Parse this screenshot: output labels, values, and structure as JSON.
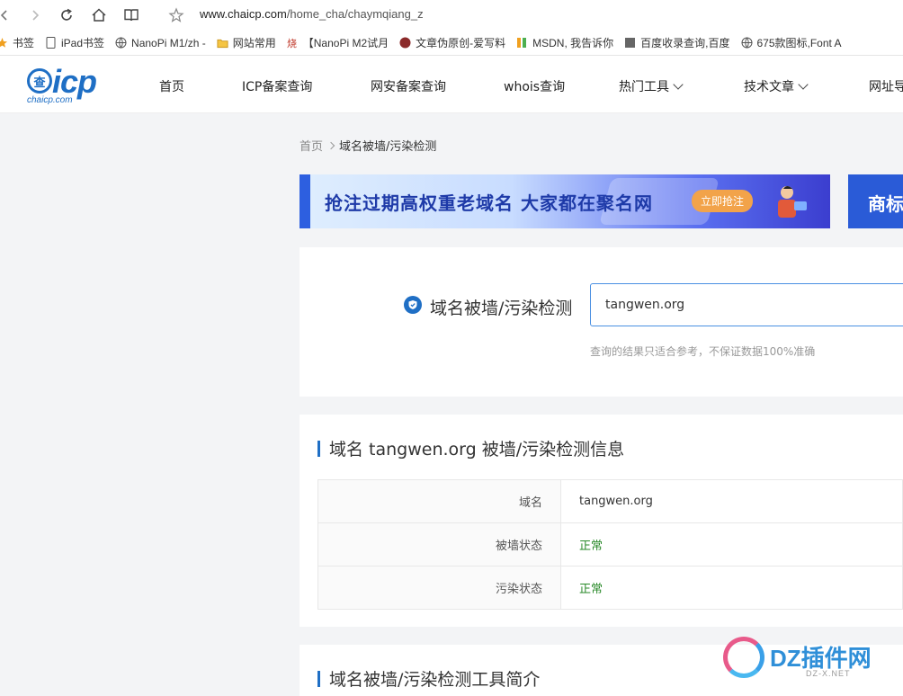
{
  "browser": {
    "url_host": "www.chaicp.com",
    "url_path": "/home_cha/chaymqiang_z"
  },
  "bookmarks": [
    {
      "label": "书签",
      "icon": "star-icon"
    },
    {
      "label": "iPad书签",
      "icon": "tablet-icon"
    },
    {
      "label": "NanoPi M1/zh -",
      "icon": "globe-icon"
    },
    {
      "label": "网站常用",
      "icon": "folder-icon"
    },
    {
      "label": "【NanoPi M2试月",
      "icon": "site-icon"
    },
    {
      "label": "文章伪原创-爱写料",
      "icon": "site-icon"
    },
    {
      "label": "MSDN, 我告诉你",
      "icon": "site-icon"
    },
    {
      "label": "百度收录查询,百度",
      "icon": "site-icon"
    },
    {
      "label": "675款图标,Font A",
      "icon": "globe-icon"
    }
  ],
  "site": {
    "logo_cha": "查",
    "logo_icp": "icp",
    "logo_domain": "chaicp.com",
    "menu": [
      "首页",
      "ICP备案查询",
      "网安备案查询",
      "whois查询",
      "热门工具",
      "技术文章",
      "网址导"
    ]
  },
  "breadcrumb": {
    "home": "首页",
    "current": "域名被墙/污染检测"
  },
  "banners": {
    "main_text": "抢注过期高权重老域名 大家都在聚名网",
    "main_button": "立即抢注",
    "side_text": "商标"
  },
  "search": {
    "title": "域名被墙/污染检测",
    "value": "tangwen.org",
    "hint": "查询的结果只适合参考，不保证数据100%准确"
  },
  "result": {
    "title": "域名 tangwen.org 被墙/污染检测信息",
    "rows": [
      {
        "key": "域名",
        "value": "tangwen.org"
      },
      {
        "key": "被墙状态",
        "value": "正常"
      },
      {
        "key": "污染状态",
        "value": "正常"
      }
    ]
  },
  "intro": {
    "title": "域名被墙/污染检测工具简介"
  },
  "watermark": {
    "text": "DZ插件网",
    "sub": "DZ-X.NET"
  },
  "colors": {
    "brand": "#1f6fc5",
    "status_ok": "#2a8a2a"
  }
}
